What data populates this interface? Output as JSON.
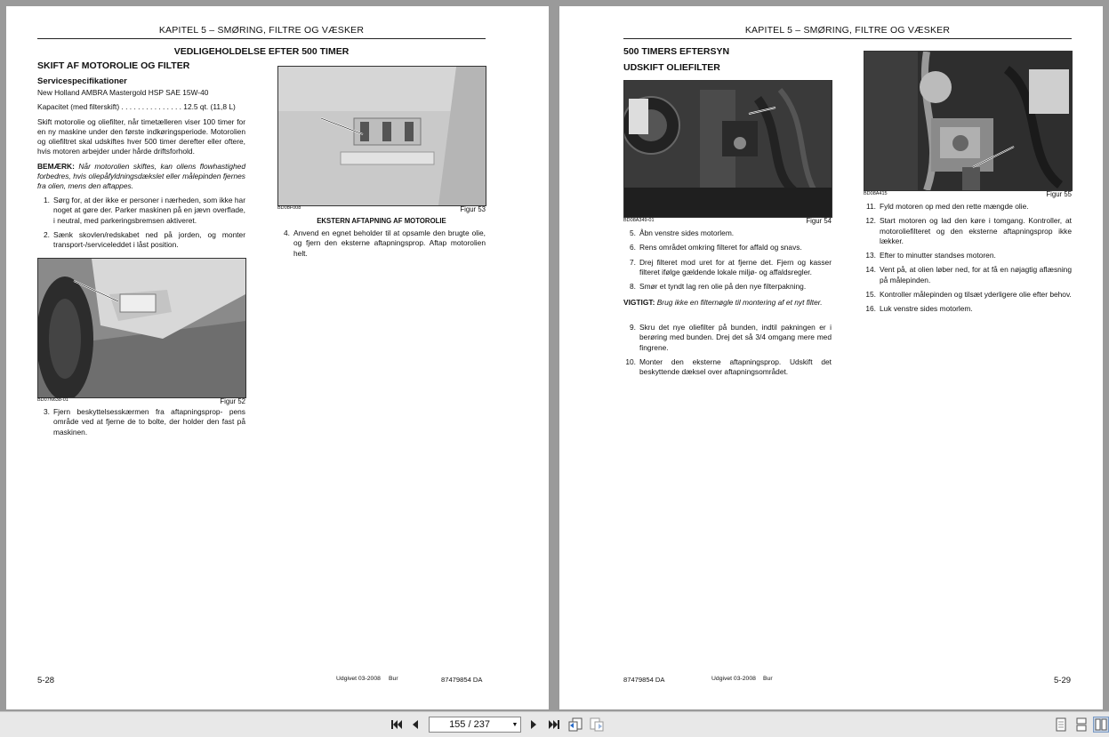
{
  "left_page": {
    "header": "KAPITEL 5 – SMØRING, FILTRE OG VÆSKER",
    "section_title": "VEDLIGEHOLDELSE EFTER 500 TIMER",
    "subtitle": "SKIFT AF MOTOROLIE OG FILTER",
    "spec_heading": "Servicespecifikationer",
    "spec_oil": "New Holland AMBRA Mastergold HSP SAE 15W-40",
    "spec_capacity": "Kapacitet (med filterskift) . . . . . . . . . . . . . . . 12.5 qt. (11,8 L)",
    "intro": "Skift motorolie og oliefilter, når timetælleren viser 100 timer for en ny maskine under den første indkøringsperiode. Motorolien og oliefiltret skal udskiftes hver 500 timer derefter eller oftere, hvis motoren arbejder under hårde driftsforhold.",
    "note_label": "BEMÆRK:",
    "note_text": "Når motorolien skiftes, kan oliens flowhastighed forbedres, hvis oliepåfyldningsdækslet eller målepinden fjernes fra olien, mens den aftappes.",
    "steps_a": [
      {
        "num": "1.",
        "text": "Sørg for, at der ikke er personer i nærheden, som ikke har noget at gøre der. Parker maskinen på en jævn overflade, i neutral, med parkeringsbremsen aktiveret."
      },
      {
        "num": "2.",
        "text": "Sænk skovlen/redskabet ned på jorden, og monter transport-/serviceleddet i låst position."
      }
    ],
    "fig52_code": "BD07N638-01",
    "fig52_label": "Figur 52",
    "steps_b": [
      {
        "num": "3.",
        "text": "Fjern beskyttelsesskærmen fra aftapningsprop- pens område ved at fjerne de to bolte, der holder den fast på maskinen."
      }
    ],
    "fig53_code": "BD08F008",
    "fig53_label": "Figur 53",
    "fig53_caption": "EKSTERN AFTAPNING AF MOTOROLIE",
    "steps_c": [
      {
        "num": "4.",
        "text": "Anvend en egnet beholder til at opsamle den brugte olie, og fjern den eksterne aftapningsprop. Aftap motorolien helt."
      }
    ],
    "page_number": "5-28",
    "footer_issued": "Udgivet 03-2008",
    "footer_bur": "Bur",
    "footer_doc": "87479854 DA"
  },
  "right_page": {
    "header": "KAPITEL 5 – SMØRING, FILTRE OG VÆSKER",
    "section_title": "500 TIMERS EFTERSYN",
    "subtitle": "UDSKIFT OLIEFILTER",
    "fig54_code": "BD08A349-01",
    "fig54_label": "Figur 54",
    "steps_a": [
      {
        "num": "5.",
        "text": "Åbn venstre sides motorlem."
      },
      {
        "num": "6.",
        "text": "Rens området omkring filteret for affald og snavs."
      },
      {
        "num": "7.",
        "text": "Drej filteret mod uret for at fjerne det. Fjern og kasser filteret ifølge gældende lokale miljø- og affaldsregler."
      },
      {
        "num": "8.",
        "text": "Smør et tyndt lag ren olie på den nye filterpakning."
      }
    ],
    "important_label": "VIGTIGT:",
    "important_text": "Brug ikke en filternøgle til montering af et nyt filter.",
    "steps_b": [
      {
        "num": "9.",
        "text": "Skru det nye oliefilter på bunden, indtil pakningen er i berøring med bunden. Drej det så 3/4 omgang mere med fingrene."
      },
      {
        "num": "10.",
        "text": "Monter den eksterne aftapningsprop. Udskift det beskyttende dæksel over aftapningsområdet."
      }
    ],
    "fig55_code": "BD08A415",
    "fig55_label": "Figur 55",
    "steps_c": [
      {
        "num": "11.",
        "text": "Fyld motoren op med den rette mængde olie."
      },
      {
        "num": "12.",
        "text": "Start motoren og lad den køre i tomgang. Kontroller, at motoroliefilteret og den eksterne aftapningsprop ikke lækker."
      },
      {
        "num": "13.",
        "text": "Efter to minutter standses motoren."
      },
      {
        "num": "14.",
        "text": "Vent på, at olien løber ned, for at få en nøjagtig aflæsning på målepinden."
      },
      {
        "num": "15.",
        "text": "Kontroller målepinden og tilsæt yderligere olie efter behov."
      },
      {
        "num": "16.",
        "text": "Luk venstre sides motorlem."
      }
    ],
    "page_number": "5-29",
    "footer_issued": "Udgivet 03-2008",
    "footer_bur": "Bur",
    "footer_doc": "87479854 DA"
  },
  "toolbar": {
    "page_indicator": "155 / 237",
    "icons": [
      "first-page-icon",
      "previous-page-icon",
      "next-page-icon",
      "last-page-icon",
      "go-back-icon",
      "go-forward-icon",
      "single-page-view-icon",
      "continuous-view-icon",
      "two-page-view-icon"
    ]
  }
}
